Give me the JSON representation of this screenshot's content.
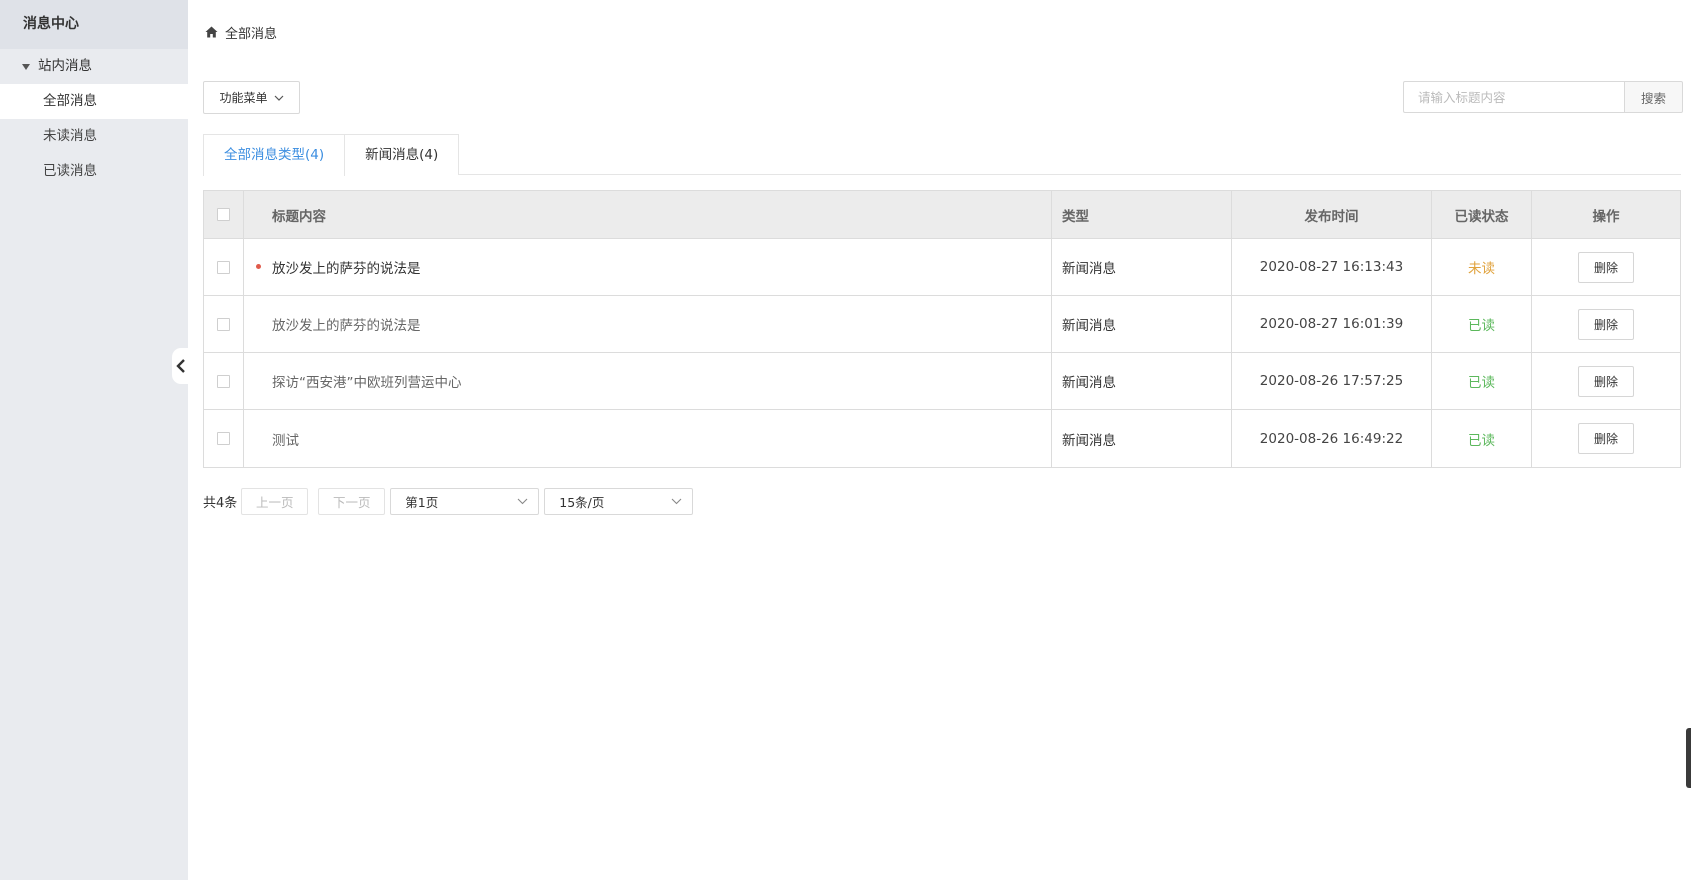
{
  "sidebar": {
    "title": "消息中心",
    "group_label": "站内消息",
    "items": [
      {
        "label": "全部消息"
      },
      {
        "label": "未读消息"
      },
      {
        "label": "已读消息"
      }
    ]
  },
  "breadcrumb": {
    "label": "全部消息",
    "icon": "home-icon"
  },
  "toolbar": {
    "func_menu_label": "功能菜单",
    "search_placeholder": "请输入标题内容",
    "search_button": "搜索"
  },
  "tabs": [
    {
      "label": "全部消息类型(4)"
    },
    {
      "label": "新闻消息(4)"
    }
  ],
  "table": {
    "columns": [
      "标题内容",
      "类型",
      "发布时间",
      "已读状态",
      "操作"
    ],
    "rows": [
      {
        "title": "放沙发上的萨芬的说法是",
        "type": "新闻消息",
        "time": "2020-08-27 16:13:43",
        "status": "未读",
        "action": "删除"
      },
      {
        "title": "放沙发上的萨芬的说法是",
        "type": "新闻消息",
        "time": "2020-08-27 16:01:39",
        "status": "已读",
        "action": "删除"
      },
      {
        "title": "探访“西安港”中欧班列营运中心",
        "type": "新闻消息",
        "time": "2020-08-26 17:57:25",
        "status": "已读",
        "action": "删除"
      },
      {
        "title": "测试",
        "type": "新闻消息",
        "time": "2020-08-26 16:49:22",
        "status": "已读",
        "action": "删除"
      }
    ]
  },
  "pagination": {
    "total": "共4条",
    "prev": "上一页",
    "next": "下一页",
    "page_select": "第1页",
    "size_select": "15条/页"
  },
  "colors": {
    "link_blue": "#3c8ee0",
    "unread_orange": "#e0a23c",
    "read_green": "#5cb85c",
    "unread_dot": "#e05a4b"
  }
}
